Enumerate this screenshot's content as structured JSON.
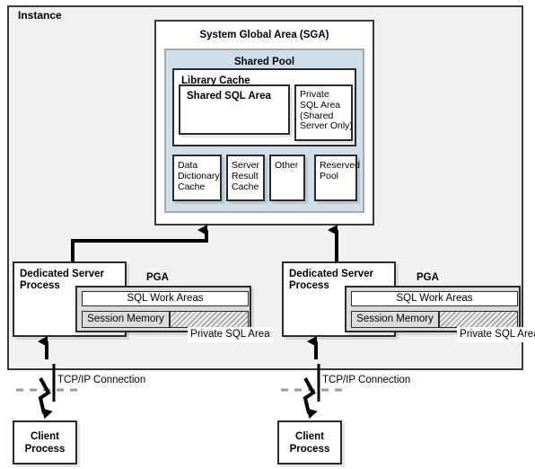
{
  "diagram": {
    "title": "Instance",
    "instance_label": "Instance"
  },
  "sga": {
    "title": "System Global Area (SGA)",
    "shared_pool": {
      "title": "Shared Pool",
      "library_cache": {
        "title": "Library Cache",
        "shared_sql_area": "Shared SQL Area",
        "private_sql_area": "Private\nSQL Area\n(Shared\nServer Only)"
      },
      "components": [
        {
          "label": "Data\nDictionary\nCache"
        },
        {
          "label": "Server\nResult\nCache"
        },
        {
          "label": "Other"
        },
        {
          "label": "Reserved\nPool"
        }
      ]
    }
  },
  "processes": [
    {
      "server_label": "Dedicated Server\nProcess",
      "pga_label": "PGA",
      "pga": {
        "sql_work_areas": "SQL Work Areas",
        "session_memory": "Session Memory",
        "private_sql_area": "Private SQL Area"
      },
      "connection_label": "TCP/IP Connection",
      "client_label": "Client\nProcess"
    },
    {
      "server_label": "Dedicated Server\nProcess",
      "pga_label": "PGA",
      "pga": {
        "sql_work_areas": "SQL Work Areas",
        "session_memory": "Session Memory",
        "private_sql_area": "Private SQL Area"
      },
      "connection_label": "TCP/IP Connection",
      "client_label": "Client\nProcess"
    }
  ],
  "colors": {
    "shared_pool_fill": "#cfdee9",
    "instance_fill": "#f1f1f1",
    "pga_fill": "#dcdcdc",
    "line": "#000000",
    "dashed_boundary": "#9a9a9a"
  }
}
